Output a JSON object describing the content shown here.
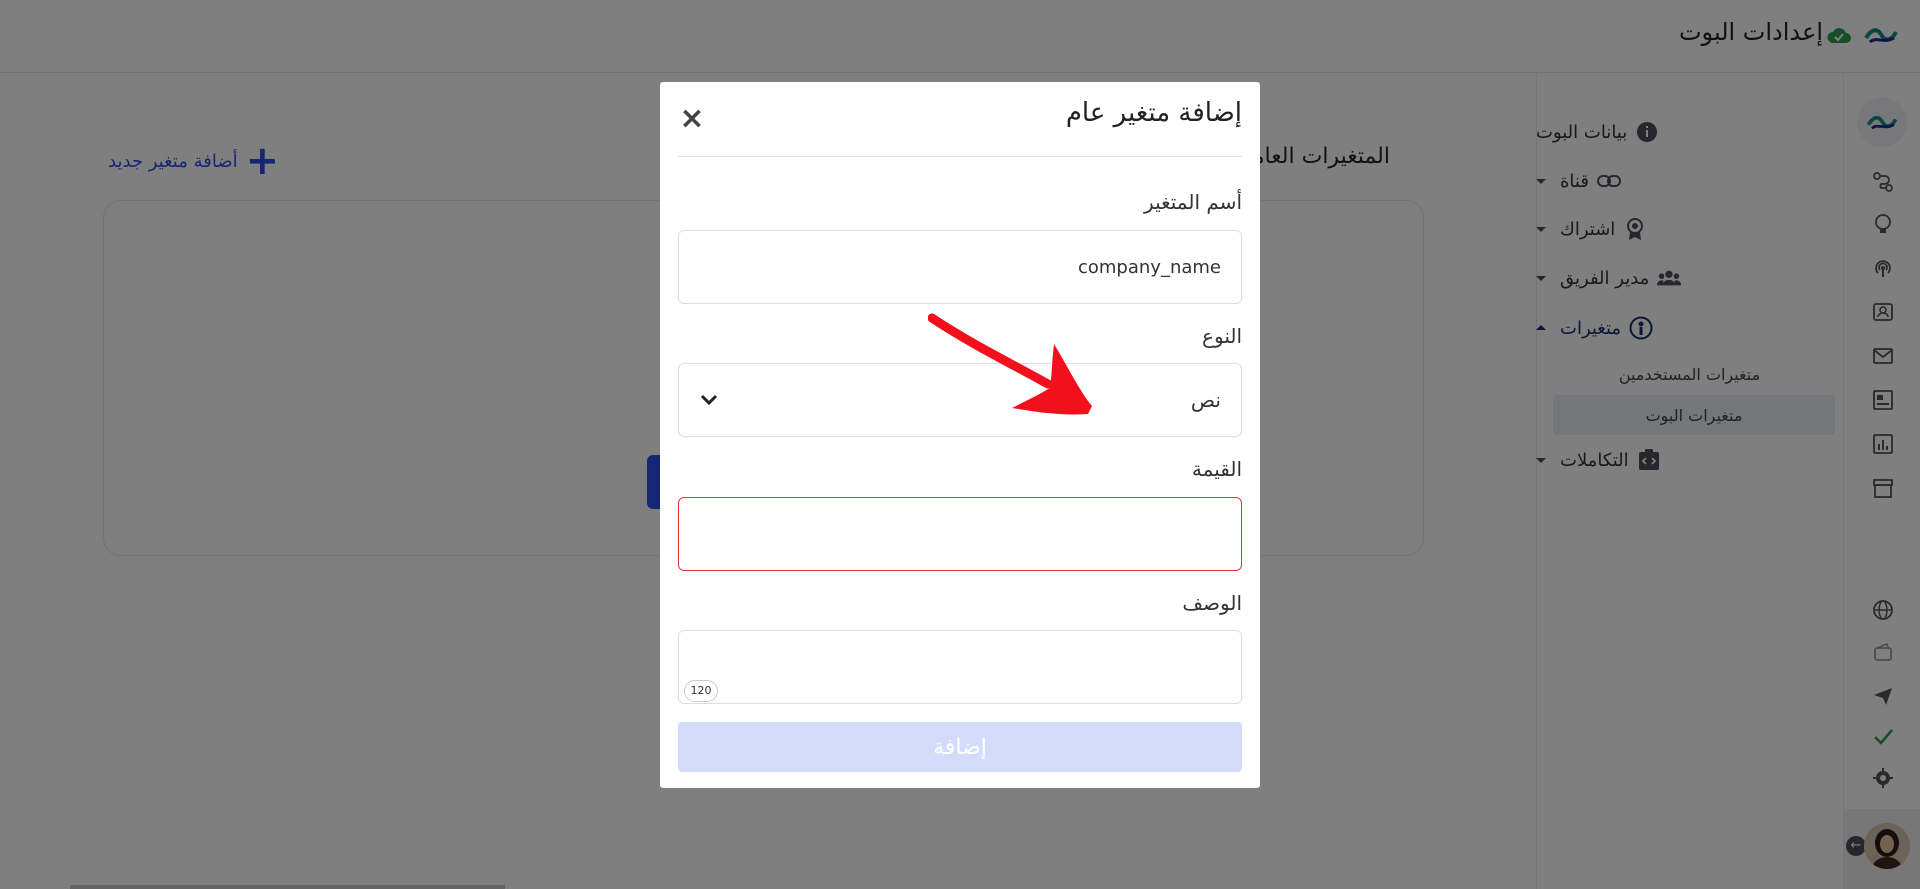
{
  "app": {
    "title": "إعدادات البوت",
    "brand_color": "#0a8c8c"
  },
  "sidebar": {
    "items": [
      {
        "label": "بيانات البوت",
        "icon": "info-icon"
      },
      {
        "label": "قناة",
        "icon": "link-icon"
      },
      {
        "label": "اشتراك",
        "icon": "badge-icon"
      },
      {
        "label": "مدير الفريق",
        "icon": "team-icon"
      },
      {
        "label": "متغيرات",
        "icon": "variables-icon"
      },
      {
        "label": "التكاملات",
        "icon": "integrations-icon"
      }
    ],
    "subitems": [
      {
        "label": "متغيرات المستخدمين"
      },
      {
        "label": "متغيرات البوت"
      }
    ]
  },
  "main": {
    "title": "المتغيرات العامة",
    "add_new_label": "أضافة متغير جديد"
  },
  "modal": {
    "title": "إضافة متغير عام",
    "name_label": "أسم المتغير",
    "name_value": "company_name",
    "type_label": "النوع",
    "type_value": "نص",
    "value_label": "القيمة",
    "value_value": "",
    "description_label": "الوصف",
    "description_value": "",
    "char_counter": "120",
    "submit_label": "إضافة",
    "close_icon": "close-icon"
  },
  "colors": {
    "accent": "#2a4ce8",
    "error": "#e53935",
    "disabled_button": "#d3dcfb",
    "annotation_arrow": "#f2101c"
  }
}
